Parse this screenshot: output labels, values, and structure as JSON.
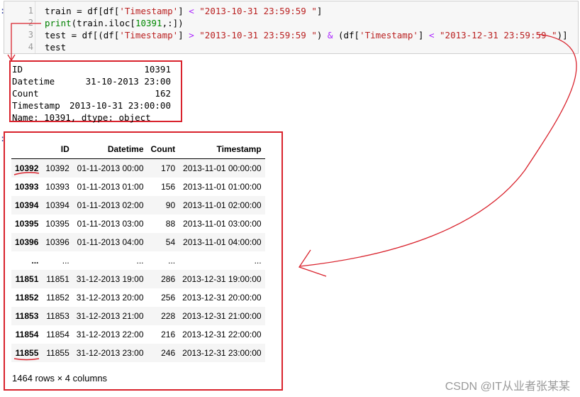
{
  "code_cell": {
    "prompt": ":",
    "line_numbers": [
      "1",
      "2",
      "3",
      "4"
    ],
    "lines": [
      [
        [
          "",
          "train = df[df["
        ],
        [
          "str",
          "'Timestamp'"
        ],
        [
          "",
          "] "
        ],
        [
          "op",
          "<"
        ],
        [
          "",
          " "
        ],
        [
          "str",
          "\"2013-10-31 23:59:59 \""
        ],
        [
          "",
          "]"
        ]
      ],
      [
        [
          "kw",
          "print"
        ],
        [
          "",
          "(train.iloc["
        ],
        [
          "num",
          "10391"
        ],
        [
          "",
          ",:])"
        ]
      ],
      [
        [
          "",
          "test = df[(df["
        ],
        [
          "str",
          "'Timestamp'"
        ],
        [
          "",
          "] "
        ],
        [
          "op",
          ">"
        ],
        [
          "",
          " "
        ],
        [
          "str",
          "\"2013-10-31 23:59:59 \""
        ],
        [
          "",
          ") "
        ],
        [
          "op",
          "&"
        ],
        [
          "",
          " (df["
        ],
        [
          "str",
          "'Timestamp'"
        ],
        [
          "",
          "] "
        ],
        [
          "op",
          "<"
        ],
        [
          "",
          " "
        ],
        [
          "str",
          "\"2013-12-31 23:59:59 \""
        ],
        [
          "",
          ")]"
        ]
      ],
      [
        [
          "",
          "test"
        ]
      ]
    ]
  },
  "print_output": {
    "rows": [
      {
        "key": "ID",
        "value": "10391"
      },
      {
        "key": "Datetime",
        "value": "31-10-2013 23:00"
      },
      {
        "key": "Count",
        "value": "162"
      },
      {
        "key": "Timestamp",
        "value": "2013-10-31 23:00:00"
      }
    ],
    "footer": "Name: 10391, dtype: object"
  },
  "output_prompt": ":",
  "dataframe": {
    "columns": [
      "",
      "ID",
      "Datetime",
      "Count",
      "Timestamp"
    ],
    "rows": [
      [
        "10392",
        "10392",
        "01-11-2013 00:00",
        "170",
        "2013-11-01 00:00:00"
      ],
      [
        "10393",
        "10393",
        "01-11-2013 01:00",
        "156",
        "2013-11-01 01:00:00"
      ],
      [
        "10394",
        "10394",
        "01-11-2013 02:00",
        "90",
        "2013-11-01 02:00:00"
      ],
      [
        "10395",
        "10395",
        "01-11-2013 03:00",
        "88",
        "2013-11-01 03:00:00"
      ],
      [
        "10396",
        "10396",
        "01-11-2013 04:00",
        "54",
        "2013-11-01 04:00:00"
      ],
      [
        "...",
        "...",
        "...",
        "...",
        "..."
      ],
      [
        "11851",
        "11851",
        "31-12-2013 19:00",
        "286",
        "2013-12-31 19:00:00"
      ],
      [
        "11852",
        "11852",
        "31-12-2013 20:00",
        "256",
        "2013-12-31 20:00:00"
      ],
      [
        "11853",
        "11853",
        "31-12-2013 21:00",
        "228",
        "2013-12-31 21:00:00"
      ],
      [
        "11854",
        "11854",
        "31-12-2013 22:00",
        "216",
        "2013-12-31 22:00:00"
      ],
      [
        "11855",
        "11855",
        "31-12-2013 23:00",
        "246",
        "2013-12-31 23:00:00"
      ]
    ],
    "shape_note": "1464 rows × 4 columns"
  },
  "watermark": "CSDN @IT从业者张某某",
  "colors": {
    "annotation_red": "#d9232d",
    "string": "#ba2121",
    "keyword": "#008000",
    "operator": "#aa22ff"
  }
}
